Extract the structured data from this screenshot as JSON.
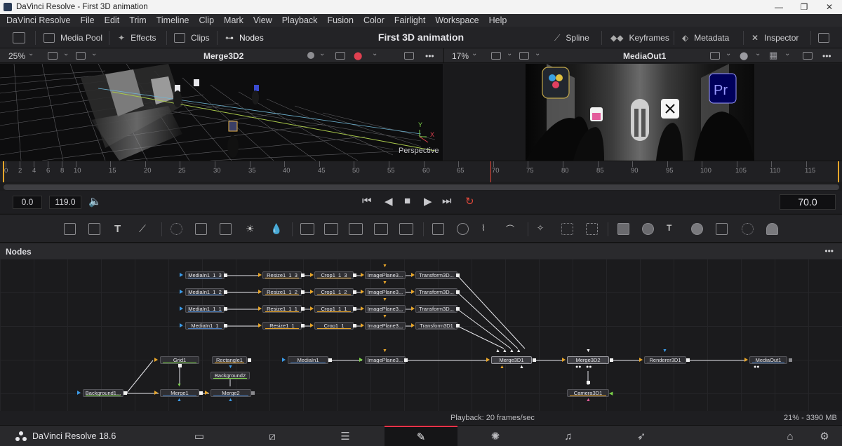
{
  "window": {
    "title": "DaVinci Resolve - First 3D animation",
    "minimize": "—",
    "restore": "❐",
    "close": "✕"
  },
  "menu": [
    "DaVinci Resolve",
    "File",
    "Edit",
    "Trim",
    "Timeline",
    "Clip",
    "Mark",
    "View",
    "Playback",
    "Fusion",
    "Color",
    "Fairlight",
    "Workspace",
    "Help"
  ],
  "toolbar": {
    "media_pool": "Media Pool",
    "effects": "Effects",
    "clips": "Clips",
    "nodes": "Nodes",
    "project_title": "First 3D animation",
    "spline": "Spline",
    "keyframes": "Keyframes",
    "metadata": "Metadata",
    "inspector": "Inspector"
  },
  "viewer_left": {
    "zoom": "25%",
    "node": "Merge3D2",
    "more": "•••",
    "overlay_label": "Perspective",
    "axis_y": "Y",
    "axis_x": "X"
  },
  "viewer_right": {
    "zoom": "17%",
    "node": "MediaOut1",
    "more": "•••"
  },
  "timeline": {
    "labels": [
      "0",
      "2",
      "4",
      "6",
      "8",
      "10",
      "15",
      "20",
      "25",
      "30",
      "35",
      "40",
      "45",
      "50",
      "55",
      "60",
      "65",
      "70",
      "75",
      "80",
      "85",
      "90",
      "95",
      "100",
      "105",
      "110",
      "115"
    ],
    "playhead_frame": 70
  },
  "transport": {
    "start": "0.0",
    "end": "119.0",
    "timecode": "70.0"
  },
  "nodes_panel": {
    "title": "Nodes",
    "more": "•••"
  },
  "nodes": [
    {
      "id": "m13",
      "label": "MediaIn1_1_3"
    },
    {
      "id": "r13",
      "label": "Resize1_1_3"
    },
    {
      "id": "c13",
      "label": "Crop1_1_3"
    },
    {
      "id": "i13",
      "label": "ImagePlane3..."
    },
    {
      "id": "t13",
      "label": "Transform3D..."
    },
    {
      "id": "m12",
      "label": "MediaIn1_1_2"
    },
    {
      "id": "r12",
      "label": "Resize1_1_2"
    },
    {
      "id": "c12",
      "label": "Crop1_1_2"
    },
    {
      "id": "i12",
      "label": "ImagePlane3..."
    },
    {
      "id": "t12",
      "label": "Transform3D..."
    },
    {
      "id": "m11",
      "label": "MediaIn1_1_1"
    },
    {
      "id": "r11",
      "label": "Resize1_1_1"
    },
    {
      "id": "c11",
      "label": "Crop1_1_1"
    },
    {
      "id": "i11",
      "label": "ImagePlane3..."
    },
    {
      "id": "t11",
      "label": "Transform3D..."
    },
    {
      "id": "m1",
      "label": "MediaIn1_1"
    },
    {
      "id": "r1",
      "label": "Resize1_1"
    },
    {
      "id": "c1",
      "label": "Crop1_1"
    },
    {
      "id": "i1",
      "label": "ImagePlane3..."
    },
    {
      "id": "t1",
      "label": "Transform3D1"
    },
    {
      "id": "grid",
      "label": "Grid1"
    },
    {
      "id": "rect",
      "label": "Rectangle1"
    },
    {
      "id": "bg2",
      "label": "Background2"
    },
    {
      "id": "bg1",
      "label": "Background1..."
    },
    {
      "id": "mg1",
      "label": "Merge1"
    },
    {
      "id": "mg2",
      "label": "Merge2"
    },
    {
      "id": "mi",
      "label": "MediaIn1"
    },
    {
      "id": "ip",
      "label": "ImagePlane3..."
    },
    {
      "id": "m3d1",
      "label": "Merge3D1"
    },
    {
      "id": "m3d2",
      "label": "Merge3D2"
    },
    {
      "id": "cam",
      "label": "Camera3D1"
    },
    {
      "id": "ren",
      "label": "Renderer3D1"
    },
    {
      "id": "out",
      "label": "MediaOut1"
    }
  ],
  "status": {
    "playback": "Playback: 20 frames/sec",
    "memory": "21% - 3390 MB"
  },
  "pagebar": {
    "brand": "DaVinci Resolve 18.6",
    "active_page": "fusion"
  },
  "colors": {
    "accent_red": "#e8334a",
    "playhead": "#e0483a",
    "pin_yellow": "#e8a62a",
    "pin_blue": "#3b9be8",
    "pin_green": "#7cd34a"
  }
}
